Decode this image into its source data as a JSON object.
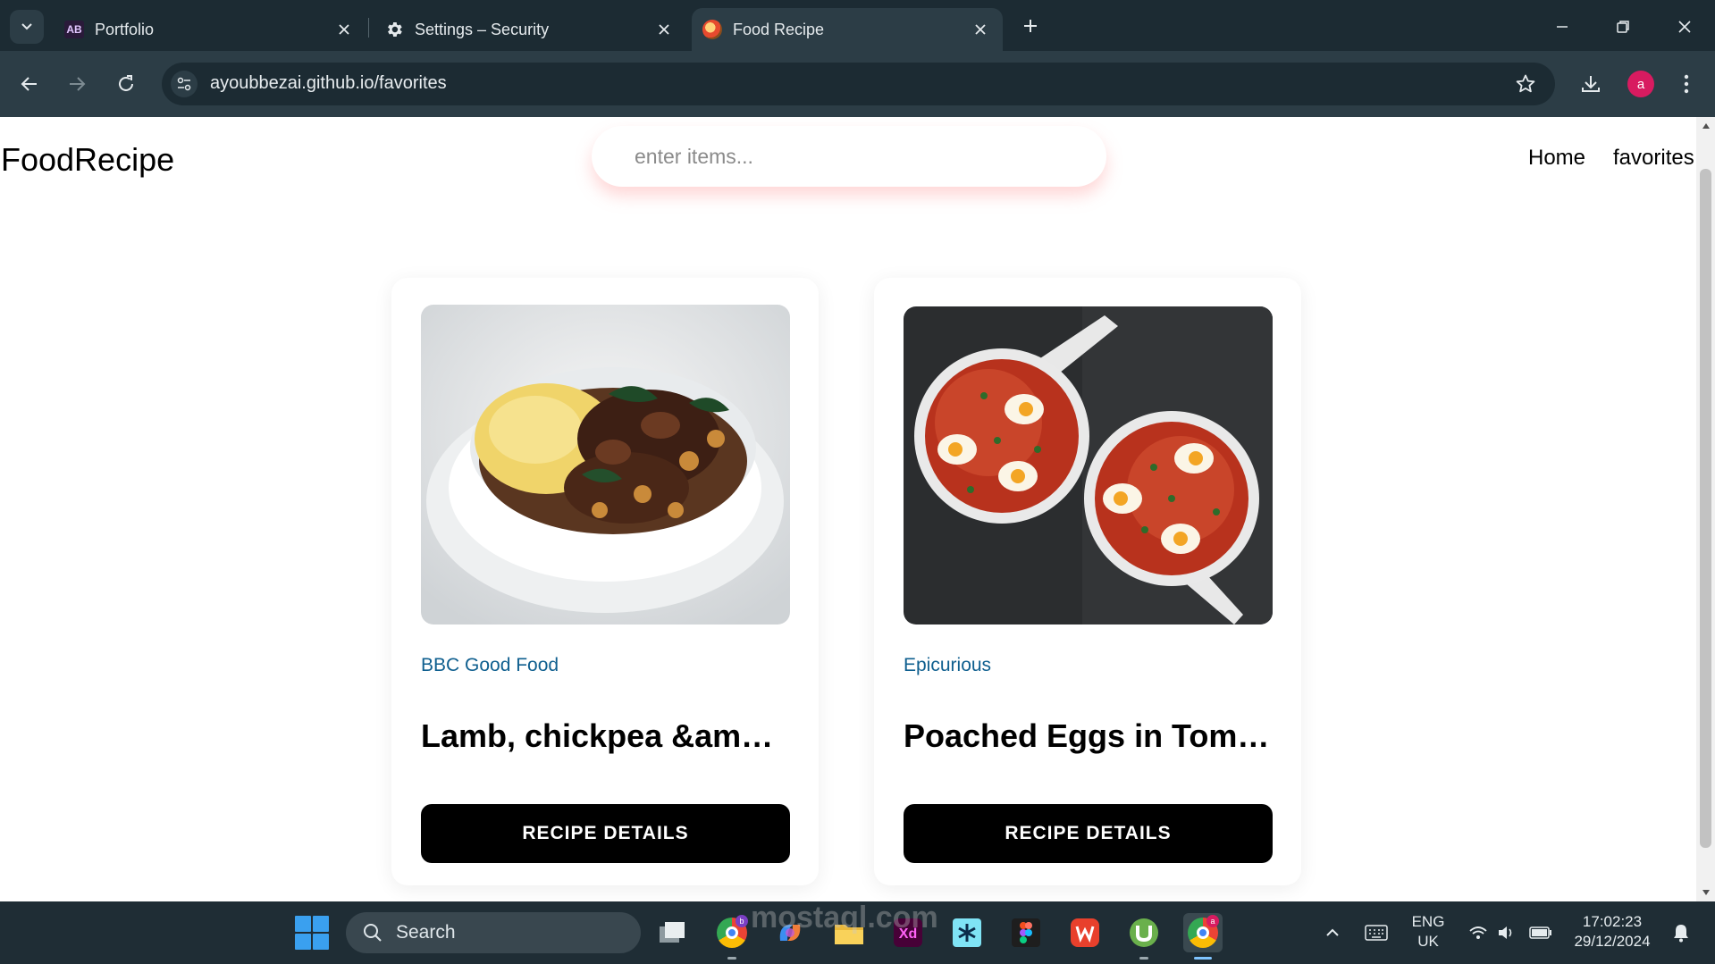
{
  "browser": {
    "tabs": [
      {
        "title": "Portfolio",
        "favicon": "AB"
      },
      {
        "title": "Settings – Security"
      },
      {
        "title": "Food Recipe"
      }
    ],
    "url": "ayoubbezai.github.io/favorites",
    "profile_initial": "a"
  },
  "header": {
    "logo": "FoodRecipe",
    "search_placeholder": "enter items...",
    "nav": [
      "Home",
      "favorites"
    ]
  },
  "recipes": [
    {
      "source": "BBC Good Food",
      "title": "Lamb, chickpea &amp;amp; spinach stew",
      "button": "RECIPE DETAILS"
    },
    {
      "source": "Epicurious",
      "title": "Poached Eggs in Tomato Sauce",
      "button": "RECIPE DETAILS"
    }
  ],
  "taskbar": {
    "search_label": "Search",
    "language": [
      "ENG",
      "UK"
    ],
    "time": "17:02:23",
    "date": "29/12/2024",
    "app_badges": {
      "chrome_b": "b",
      "chrome_a": "a"
    }
  },
  "watermark": "mostaql.com"
}
